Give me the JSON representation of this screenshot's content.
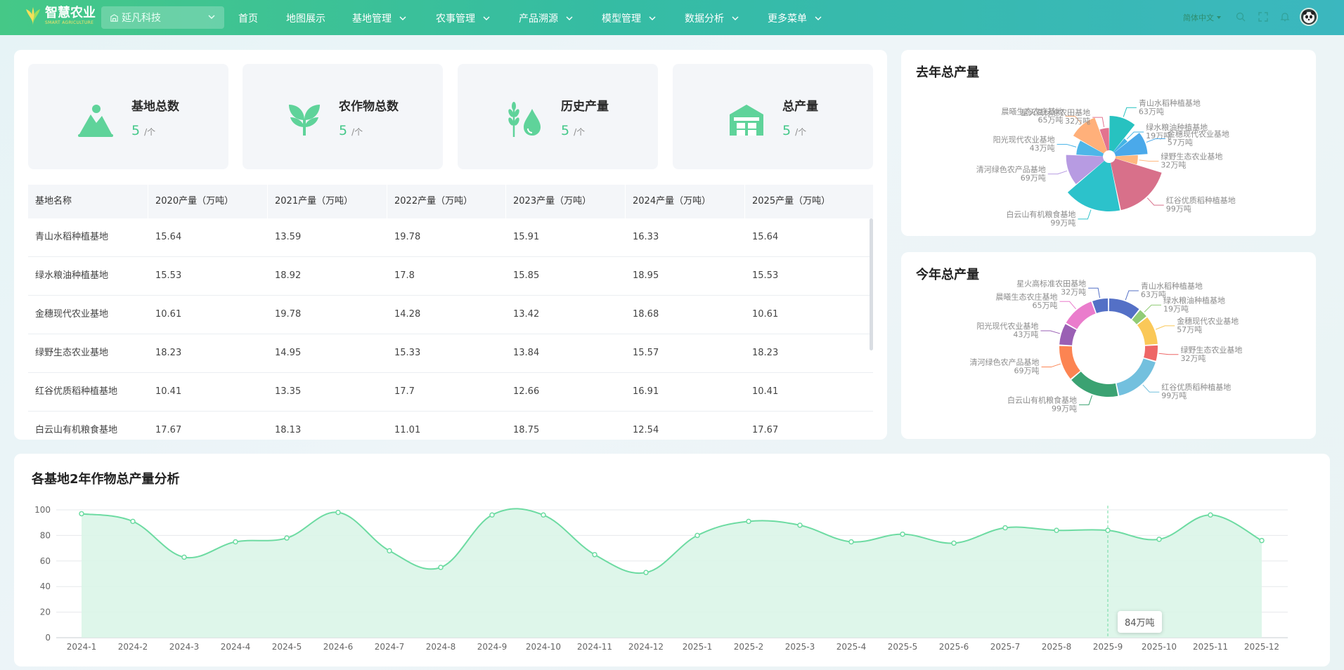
{
  "header": {
    "logo_title": "智慧农业",
    "logo_sub": "SMART AGRICULTURE",
    "org": "延凡科技",
    "nav": [
      {
        "label": "首页",
        "dropdown": false
      },
      {
        "label": "地图展示",
        "dropdown": false
      },
      {
        "label": "基地管理",
        "dropdown": true
      },
      {
        "label": "农事管理",
        "dropdown": true
      },
      {
        "label": "产品溯源",
        "dropdown": true
      },
      {
        "label": "模型管理",
        "dropdown": true
      },
      {
        "label": "数据分析",
        "dropdown": true
      },
      {
        "label": "更多菜单",
        "dropdown": true
      }
    ],
    "lang": "简体中文"
  },
  "stats": [
    {
      "label": "基地总数",
      "value": "5",
      "unit": "/个",
      "icon": "mountain-icon"
    },
    {
      "label": "农作物总数",
      "value": "5",
      "unit": "/个",
      "icon": "sprout-icon"
    },
    {
      "label": "历史产量",
      "value": "5",
      "unit": "/个",
      "icon": "wheat-drop-icon"
    },
    {
      "label": "总产量",
      "value": "5",
      "unit": "/个",
      "icon": "warehouse-icon"
    }
  ],
  "table": {
    "columns": [
      "基地名称",
      "2020产量（万吨）",
      "2021产量（万吨）",
      "2022产量（万吨）",
      "2023产量（万吨）",
      "2024产量（万吨）",
      "2025产量（万吨）"
    ],
    "rows": [
      [
        "青山水稻种植基地",
        "15.64",
        "13.59",
        "19.78",
        "15.91",
        "16.33",
        "15.64"
      ],
      [
        "绿水粮油种植基地",
        "15.53",
        "18.92",
        "17.8",
        "15.85",
        "18.95",
        "15.53"
      ],
      [
        "金穗现代农业基地",
        "10.61",
        "19.78",
        "14.28",
        "13.42",
        "18.68",
        "10.61"
      ],
      [
        "绿野生态农业基地",
        "18.23",
        "14.95",
        "15.33",
        "13.84",
        "15.57",
        "18.23"
      ],
      [
        "红谷优质稻种植基地",
        "10.41",
        "13.35",
        "17.7",
        "12.66",
        "16.91",
        "10.41"
      ],
      [
        "白云山有机粮食基地",
        "17.67",
        "18.13",
        "11.01",
        "18.75",
        "12.54",
        "17.67"
      ]
    ]
  },
  "last_year": {
    "title": "去年总产量",
    "chart_data": {
      "type": "pie",
      "variant": "rose",
      "slices": [
        {
          "name": "青山水稻种植基地",
          "value": 63,
          "label": "63万吨",
          "color": "#27c2c0"
        },
        {
          "name": "绿水粮油种植基地",
          "value": 19,
          "label": "19万吨",
          "color": "#43b4e6"
        },
        {
          "name": "金穗现代农业基地",
          "value": 57,
          "label": "57万吨",
          "color": "#4aa9ea"
        },
        {
          "name": "绿野生态农业基地",
          "value": 32,
          "label": "32万吨",
          "color": "#ffb880"
        },
        {
          "name": "红谷优质稻种植基地",
          "value": 99,
          "label": "99万吨",
          "color": "#d8708a"
        },
        {
          "name": "白云山有机粮食基地",
          "value": 99,
          "label": "99万吨",
          "color": "#2cc2cb"
        },
        {
          "name": "清河绿色农产品基地",
          "value": 69,
          "label": "69万吨",
          "color": "#b79be2"
        },
        {
          "name": "阳光现代农业基地",
          "value": 43,
          "label": "43万吨",
          "color": "#4eb6e8"
        },
        {
          "name": "晨曦生态农庄基地",
          "value": 65,
          "label": "65万吨",
          "color": "#ffb07a"
        },
        {
          "name": "星火高标准农田基地",
          "value": 32,
          "label": "32万吨",
          "color": "#e3738f"
        }
      ]
    }
  },
  "this_year": {
    "title": "今年总产量",
    "chart_data": {
      "type": "pie",
      "variant": "donut",
      "slices": [
        {
          "name": "青山水稻种植基地",
          "value": 63,
          "label": "63万吨",
          "color": "#5470c6"
        },
        {
          "name": "绿水粮油种植基地",
          "value": 19,
          "label": "19万吨",
          "color": "#91cc75"
        },
        {
          "name": "金穗现代农业基地",
          "value": 57,
          "label": "57万吨",
          "color": "#fac858"
        },
        {
          "name": "绿野生态农业基地",
          "value": 32,
          "label": "32万吨",
          "color": "#ee6666"
        },
        {
          "name": "红谷优质稻种植基地",
          "value": 99,
          "label": "99万吨",
          "color": "#73c0de"
        },
        {
          "name": "白云山有机粮食基地",
          "value": 99,
          "label": "99万吨",
          "color": "#3ba272"
        },
        {
          "name": "清河绿色农产品基地",
          "value": 69,
          "label": "69万吨",
          "color": "#fc8452"
        },
        {
          "name": "阳光现代农业基地",
          "value": 43,
          "label": "43万吨",
          "color": "#9a60b4"
        },
        {
          "name": "晨曦生态农庄基地",
          "value": 65,
          "label": "65万吨",
          "color": "#ea7ccc"
        },
        {
          "name": "星火高标准农田基地",
          "value": 32,
          "label": "32万吨",
          "color": "#5470c6"
        }
      ]
    }
  },
  "trend": {
    "title": "各基地2年作物总产量分析",
    "tooltip": "84万吨",
    "chart_data": {
      "type": "area",
      "x": [
        "2024-1",
        "2024-2",
        "2024-3",
        "2024-4",
        "2024-5",
        "2024-6",
        "2024-7",
        "2024-8",
        "2024-9",
        "2024-10",
        "2024-11",
        "2024-12",
        "2025-1",
        "2025-2",
        "2025-3",
        "2025-4",
        "2025-5",
        "2025-6",
        "2025-7",
        "2025-8",
        "2025-9",
        "2025-10",
        "2025-11",
        "2025-12"
      ],
      "y": [
        97,
        91,
        63,
        75,
        78,
        98,
        68,
        55,
        96,
        96,
        65,
        51,
        80,
        91,
        88,
        75,
        81,
        74,
        86,
        84,
        84,
        77,
        96,
        76
      ],
      "ylim": [
        0,
        100
      ],
      "yticks": [
        0,
        20,
        40,
        60,
        80,
        100
      ],
      "grid": true,
      "color": "#6ddba2",
      "fill": "#d8f5e6",
      "highlight_index": 20
    }
  }
}
